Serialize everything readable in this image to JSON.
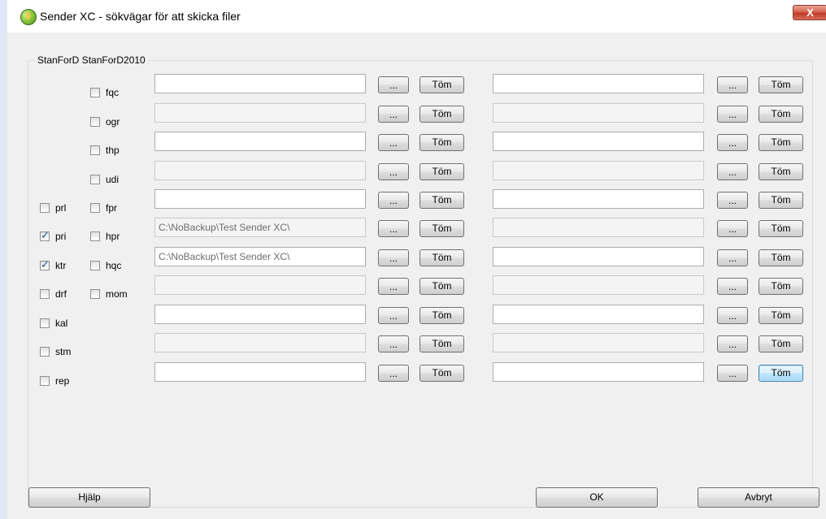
{
  "window": {
    "title": "Sender XC - sökvägar för att skicka filer",
    "close_label": "X"
  },
  "group": {
    "caption": "StanForD StanForD2010"
  },
  "left_checkboxes": [
    {
      "label": "prl",
      "checked": false
    },
    {
      "label": "pri",
      "checked": true
    },
    {
      "label": "ktr",
      "checked": true
    },
    {
      "label": "drf",
      "checked": false
    },
    {
      "label": "kal",
      "checked": false
    },
    {
      "label": "stm",
      "checked": false
    },
    {
      "label": "rep",
      "checked": false
    }
  ],
  "inner_checkboxes": [
    {
      "label": "fqc",
      "checked": false
    },
    {
      "label": "ogr",
      "checked": false
    },
    {
      "label": "thp",
      "checked": false
    },
    {
      "label": "udi",
      "checked": false
    },
    {
      "label": "fpr",
      "checked": false
    },
    {
      "label": "hpr",
      "checked": false
    },
    {
      "label": "hqc",
      "checked": false
    },
    {
      "label": "mom",
      "checked": false
    }
  ],
  "rows": [
    {
      "path1": "",
      "enabled1": true,
      "path2": "",
      "enabled2": true
    },
    {
      "path1": "",
      "enabled1": false,
      "path2": "",
      "enabled2": false
    },
    {
      "path1": "",
      "enabled1": true,
      "path2": "",
      "enabled2": true
    },
    {
      "path1": "",
      "enabled1": false,
      "path2": "",
      "enabled2": false
    },
    {
      "path1": "",
      "enabled1": true,
      "path2": "",
      "enabled2": true
    },
    {
      "path1": "C:\\NoBackup\\Test Sender XC\\",
      "enabled1": false,
      "path2": "",
      "enabled2": false
    },
    {
      "path1": "C:\\NoBackup\\Test Sender XC\\",
      "enabled1": true,
      "path2": "",
      "enabled2": true
    },
    {
      "path1": "",
      "enabled1": false,
      "path2": "",
      "enabled2": false
    },
    {
      "path1": "",
      "enabled1": true,
      "path2": "",
      "enabled2": true
    },
    {
      "path1": "",
      "enabled1": false,
      "path2": "",
      "enabled2": false
    },
    {
      "path1": "",
      "enabled1": true,
      "path2": "",
      "enabled2": true
    }
  ],
  "labels": {
    "browse": "...",
    "clear": "Töm"
  },
  "buttons": {
    "help": "Hjälp",
    "ok": "OK",
    "cancel": "Avbryt"
  }
}
